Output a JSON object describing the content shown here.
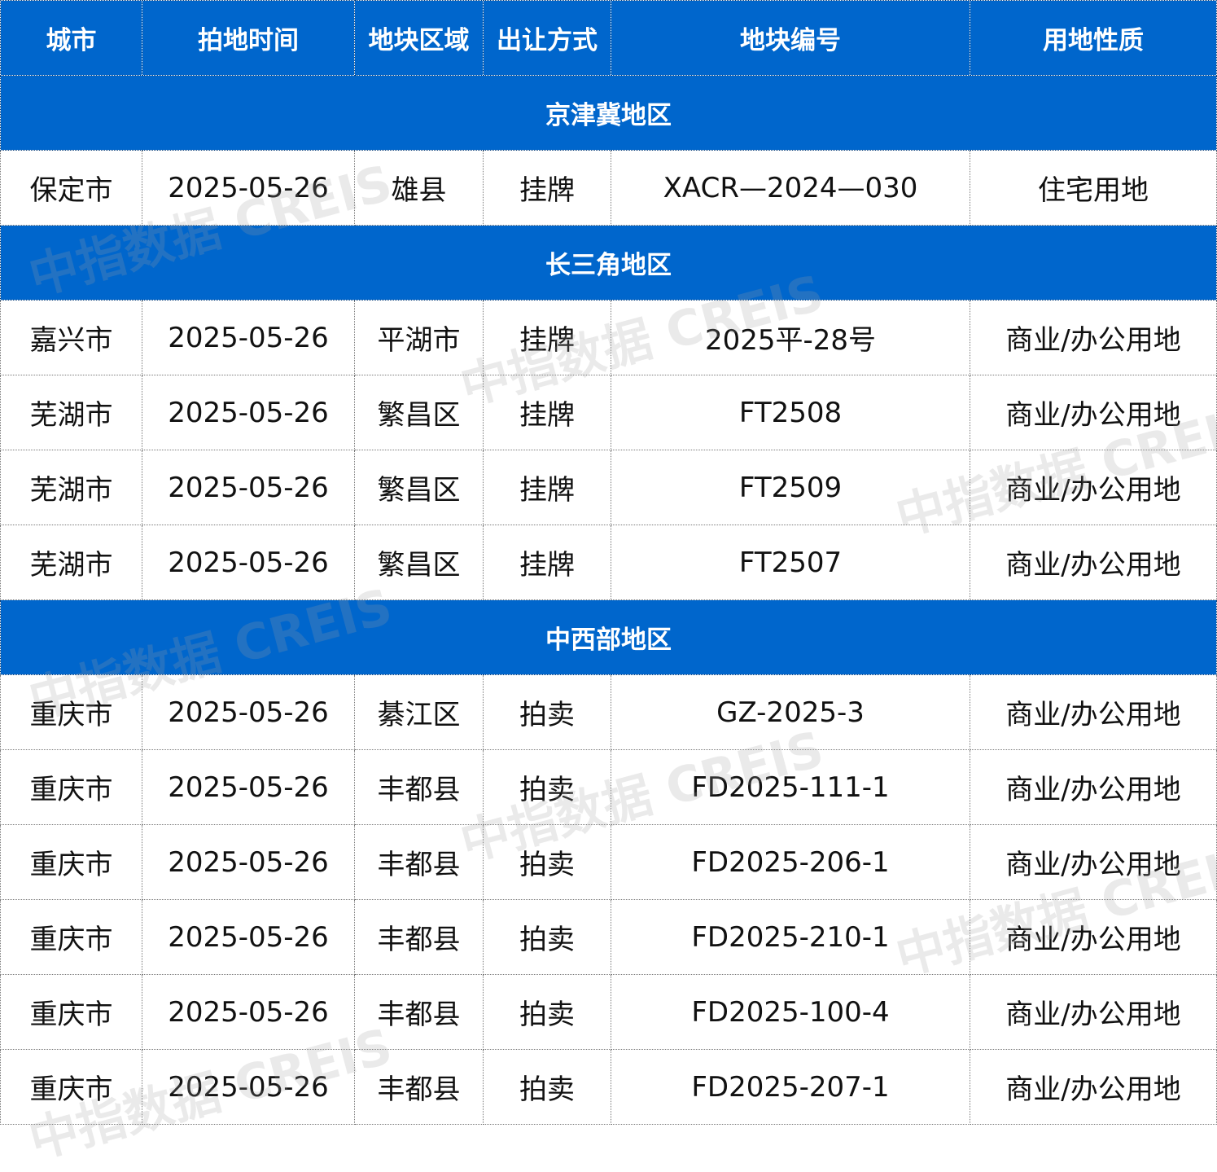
{
  "header": {
    "city": "城市",
    "date": "拍地时间",
    "area": "地块区域",
    "method": "出让方式",
    "code": "地块编号",
    "usage": "用地性质"
  },
  "regions": [
    {
      "name": "京津冀地区",
      "rows": [
        {
          "city": "保定市",
          "date": "2025-05-26",
          "area": "雄县",
          "method": "挂牌",
          "code": "XACR—2024—030",
          "usage": "住宅用地"
        }
      ]
    },
    {
      "name": "长三角地区",
      "rows": [
        {
          "city": "嘉兴市",
          "date": "2025-05-26",
          "area": "平湖市",
          "method": "挂牌",
          "code": "2025平-28号",
          "usage": "商业/办公用地"
        },
        {
          "city": "芜湖市",
          "date": "2025-05-26",
          "area": "繁昌区",
          "method": "挂牌",
          "code": "FT2508",
          "usage": "商业/办公用地"
        },
        {
          "city": "芜湖市",
          "date": "2025-05-26",
          "area": "繁昌区",
          "method": "挂牌",
          "code": "FT2509",
          "usage": "商业/办公用地"
        },
        {
          "city": "芜湖市",
          "date": "2025-05-26",
          "area": "繁昌区",
          "method": "挂牌",
          "code": "FT2507",
          "usage": "商业/办公用地"
        }
      ]
    },
    {
      "name": "中西部地区",
      "rows": [
        {
          "city": "重庆市",
          "date": "2025-05-26",
          "area": "綦江区",
          "method": "拍卖",
          "code": "GZ-2025-3",
          "usage": "商业/办公用地"
        },
        {
          "city": "重庆市",
          "date": "2025-05-26",
          "area": "丰都县",
          "method": "拍卖",
          "code": "FD2025-111-1",
          "usage": "商业/办公用地"
        },
        {
          "city": "重庆市",
          "date": "2025-05-26",
          "area": "丰都县",
          "method": "拍卖",
          "code": "FD2025-206-1",
          "usage": "商业/办公用地"
        },
        {
          "city": "重庆市",
          "date": "2025-05-26",
          "area": "丰都县",
          "method": "拍卖",
          "code": "FD2025-210-1",
          "usage": "商业/办公用地"
        },
        {
          "city": "重庆市",
          "date": "2025-05-26",
          "area": "丰都县",
          "method": "拍卖",
          "code": "FD2025-100-4",
          "usage": "商业/办公用地"
        },
        {
          "city": "重庆市",
          "date": "2025-05-26",
          "area": "丰都县",
          "method": "拍卖",
          "code": "FD2025-207-1",
          "usage": "商业/办公用地"
        }
      ]
    }
  ],
  "watermark": "中指数据 CREIS",
  "colors": {
    "header_bg": "#0066cc",
    "header_text": "#ffffff",
    "cell_text": "#111111"
  }
}
